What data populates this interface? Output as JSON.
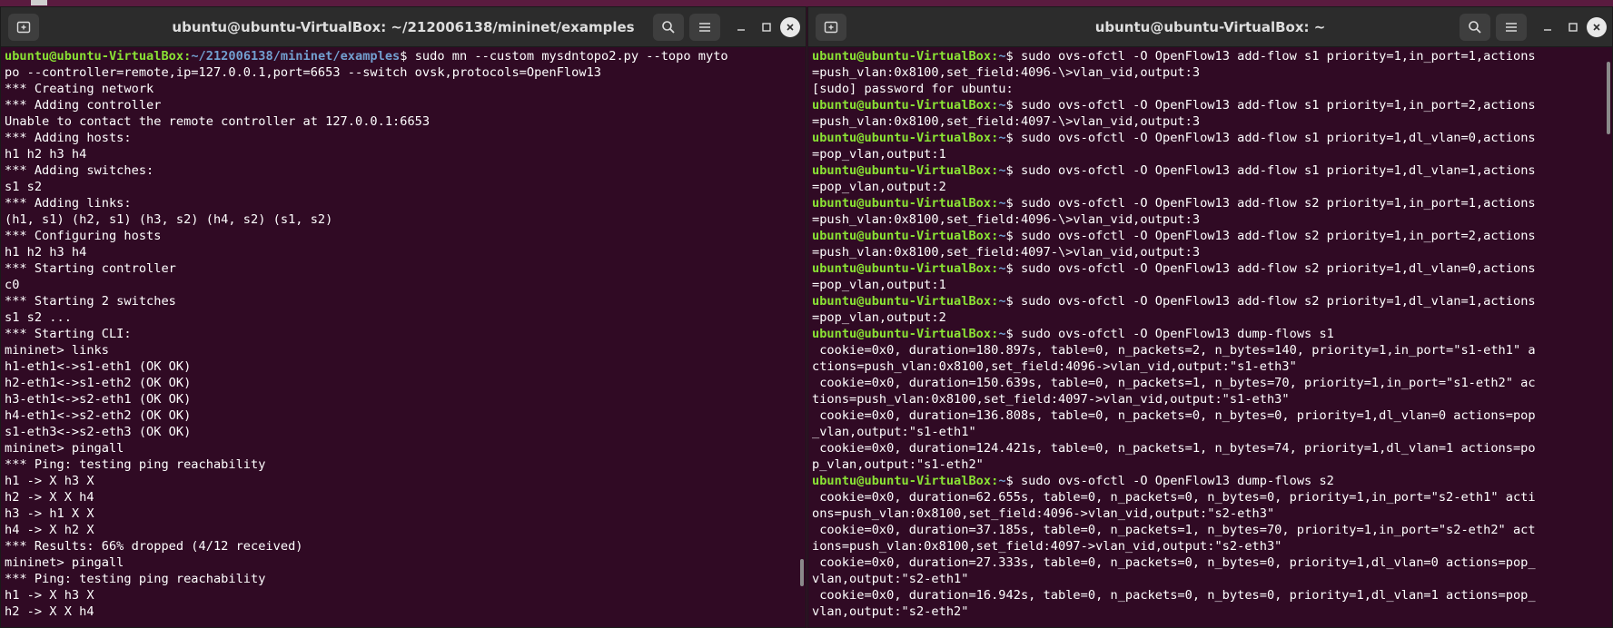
{
  "left_window": {
    "title": "ubuntu@ubuntu-VirtualBox: ~/212006138/mininet/examples",
    "lines": [
      {
        "user": "ubuntu@ubuntu-VirtualBox",
        "path": "~/212006138/mininet/examples",
        "text": "$ sudo mn --custom mysdntopo2.py --topo myto"
      },
      {
        "text": "po --controller=remote,ip=127.0.0.1,port=6653 --switch ovsk,protocols=OpenFlow13"
      },
      {
        "text": "*** Creating network"
      },
      {
        "text": "*** Adding controller"
      },
      {
        "text": "Unable to contact the remote controller at 127.0.0.1:6653"
      },
      {
        "text": "*** Adding hosts:"
      },
      {
        "text": "h1 h2 h3 h4"
      },
      {
        "text": "*** Adding switches:"
      },
      {
        "text": "s1 s2"
      },
      {
        "text": "*** Adding links:"
      },
      {
        "text": "(h1, s1) (h2, s1) (h3, s2) (h4, s2) (s1, s2)"
      },
      {
        "text": "*** Configuring hosts"
      },
      {
        "text": "h1 h2 h3 h4"
      },
      {
        "text": "*** Starting controller"
      },
      {
        "text": "c0"
      },
      {
        "text": "*** Starting 2 switches"
      },
      {
        "text": "s1 s2 ..."
      },
      {
        "text": "*** Starting CLI:"
      },
      {
        "text": "mininet> links"
      },
      {
        "text": "h1-eth1<->s1-eth1 (OK OK)"
      },
      {
        "text": "h2-eth1<->s1-eth2 (OK OK)"
      },
      {
        "text": "h3-eth1<->s2-eth1 (OK OK)"
      },
      {
        "text": "h4-eth1<->s2-eth2 (OK OK)"
      },
      {
        "text": "s1-eth3<->s2-eth3 (OK OK)"
      },
      {
        "text": "mininet> pingall"
      },
      {
        "text": "*** Ping: testing ping reachability"
      },
      {
        "text": "h1 -> X h3 X"
      },
      {
        "text": "h2 -> X X h4"
      },
      {
        "text": "h3 -> h1 X X"
      },
      {
        "text": "h4 -> X h2 X"
      },
      {
        "text": "*** Results: 66% dropped (4/12 received)"
      },
      {
        "text": "mininet> pingall"
      },
      {
        "text": "*** Ping: testing ping reachability"
      },
      {
        "text": "h1 -> X h3 X"
      },
      {
        "text": "h2 -> X X h4"
      }
    ]
  },
  "right_window": {
    "title": "ubuntu@ubuntu-VirtualBox: ~",
    "lines": [
      {
        "user": "ubuntu@ubuntu-VirtualBox",
        "path": "~",
        "text": "$ sudo ovs-ofctl -O OpenFlow13 add-flow s1 priority=1,in_port=1,actions"
      },
      {
        "text": "=push_vlan:0x8100,set_field:4096-\\>vlan_vid,output:3"
      },
      {
        "text": "[sudo] password for ubuntu:"
      },
      {
        "user": "ubuntu@ubuntu-VirtualBox",
        "path": "~",
        "text": "$ sudo ovs-ofctl -O OpenFlow13 add-flow s1 priority=1,in_port=2,actions"
      },
      {
        "text": "=push_vlan:0x8100,set_field:4097-\\>vlan_vid,output:3"
      },
      {
        "user": "ubuntu@ubuntu-VirtualBox",
        "path": "~",
        "text": "$ sudo ovs-ofctl -O OpenFlow13 add-flow s1 priority=1,dl_vlan=0,actions"
      },
      {
        "text": "=pop_vlan,output:1"
      },
      {
        "user": "ubuntu@ubuntu-VirtualBox",
        "path": "~",
        "text": "$ sudo ovs-ofctl -O OpenFlow13 add-flow s1 priority=1,dl_vlan=1,actions"
      },
      {
        "text": "=pop_vlan,output:2"
      },
      {
        "user": "ubuntu@ubuntu-VirtualBox",
        "path": "~",
        "text": "$ sudo ovs-ofctl -O OpenFlow13 add-flow s2 priority=1,in_port=1,actions"
      },
      {
        "text": "=push_vlan:0x8100,set_field:4096-\\>vlan_vid,output:3"
      },
      {
        "user": "ubuntu@ubuntu-VirtualBox",
        "path": "~",
        "text": "$ sudo ovs-ofctl -O OpenFlow13 add-flow s2 priority=1,in_port=2,actions"
      },
      {
        "text": "=push_vlan:0x8100,set_field:4097-\\>vlan_vid,output:3"
      },
      {
        "user": "ubuntu@ubuntu-VirtualBox",
        "path": "~",
        "text": "$ sudo ovs-ofctl -O OpenFlow13 add-flow s2 priority=1,dl_vlan=0,actions"
      },
      {
        "text": "=pop_vlan,output:1"
      },
      {
        "user": "ubuntu@ubuntu-VirtualBox",
        "path": "~",
        "text": "$ sudo ovs-ofctl -O OpenFlow13 add-flow s2 priority=1,dl_vlan=1,actions"
      },
      {
        "text": "=pop_vlan,output:2"
      },
      {
        "user": "ubuntu@ubuntu-VirtualBox",
        "path": "~",
        "text": "$ sudo ovs-ofctl -O OpenFlow13 dump-flows s1"
      },
      {
        "text": " cookie=0x0, duration=180.897s, table=0, n_packets=2, n_bytes=140, priority=1,in_port=\"s1-eth1\" a"
      },
      {
        "text": "ctions=push_vlan:0x8100,set_field:4096->vlan_vid,output:\"s1-eth3\""
      },
      {
        "text": " cookie=0x0, duration=150.639s, table=0, n_packets=1, n_bytes=70, priority=1,in_port=\"s1-eth2\" ac"
      },
      {
        "text": "tions=push_vlan:0x8100,set_field:4097->vlan_vid,output:\"s1-eth3\""
      },
      {
        "text": " cookie=0x0, duration=136.808s, table=0, n_packets=0, n_bytes=0, priority=1,dl_vlan=0 actions=pop"
      },
      {
        "text": "_vlan,output:\"s1-eth1\""
      },
      {
        "text": " cookie=0x0, duration=124.421s, table=0, n_packets=1, n_bytes=74, priority=1,dl_vlan=1 actions=po"
      },
      {
        "text": "p_vlan,output:\"s1-eth2\""
      },
      {
        "user": "ubuntu@ubuntu-VirtualBox",
        "path": "~",
        "text": "$ sudo ovs-ofctl -O OpenFlow13 dump-flows s2"
      },
      {
        "text": " cookie=0x0, duration=62.655s, table=0, n_packets=0, n_bytes=0, priority=1,in_port=\"s2-eth1\" acti"
      },
      {
        "text": "ons=push_vlan:0x8100,set_field:4096->vlan_vid,output:\"s2-eth3\""
      },
      {
        "text": " cookie=0x0, duration=37.185s, table=0, n_packets=1, n_bytes=70, priority=1,in_port=\"s2-eth2\" act"
      },
      {
        "text": "ions=push_vlan:0x8100,set_field:4097->vlan_vid,output:\"s2-eth3\""
      },
      {
        "text": " cookie=0x0, duration=27.333s, table=0, n_packets=0, n_bytes=0, priority=1,dl_vlan=0 actions=pop_"
      },
      {
        "text": "vlan,output:\"s2-eth1\""
      },
      {
        "text": " cookie=0x0, duration=16.942s, table=0, n_packets=0, n_bytes=0, priority=1,dl_vlan=1 actions=pop_"
      },
      {
        "text": "vlan,output:\"s2-eth2\""
      }
    ]
  },
  "icons": {
    "new_tab": "new-tab-icon",
    "search": "search-icon",
    "menu": "hamburger-menu-icon",
    "minimize": "minimize-icon",
    "maximize": "maximize-icon",
    "close": "close-icon"
  },
  "colors": {
    "terminal_bg": "#300a24",
    "titlebar_bg": "#2c2c2c",
    "prompt_user": "#8ae234",
    "prompt_path": "#729fcf",
    "text": "#ffffff"
  }
}
